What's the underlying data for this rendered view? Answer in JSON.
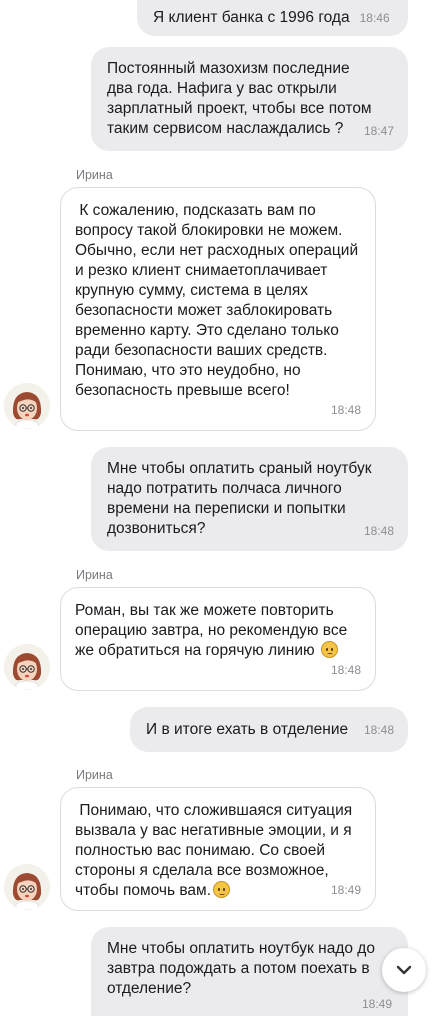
{
  "messages": [
    {
      "type": "out",
      "text": "Я клиент банка с 1996 года",
      "time": "18:46"
    },
    {
      "type": "out",
      "text": "Постоянный мазохизм последние два года. Нафига у вас открыли зарплатный проект, чтобы все потом таким сервисом наслаждались ?",
      "time": "18:47"
    },
    {
      "type": "in",
      "sender": "Ирина",
      "text": " К сожалению, подсказать вам по вопросу такой блокировки не можем. Обычно, если нет расходных операций и резко клиент снимаетоплачивает крупную сумму, система в целях безопасности может заблокировать временно карту. Это сделано только ради безопасности ваших средств. Понимаю, что это неудобно, но безопасность превыше всего!",
      "time": "18:48"
    },
    {
      "type": "out",
      "text": "Мне чтобы оплатить сраный ноутбук надо потратить полчаса личного времени на переписки и попытки дозвониться?",
      "time": "18:48"
    },
    {
      "type": "in",
      "sender": "Ирина",
      "text": "Роман, вы так же можете повторить операцию завтра, но рекомендую все же обратиться на горячую линию",
      "time": "18:48"
    },
    {
      "type": "out",
      "text": "И в итоге ехать в отделение",
      "time": "18:48"
    },
    {
      "type": "in",
      "sender": "Ирина",
      "text": " Понимаю, что сложившаяся ситуация вызвала у вас негативные эмоции, и я полностью вас понимаю. Со своей стороны я сделала все возможное, чтобы помочь вам.",
      "time": "18:49"
    },
    {
      "type": "out",
      "text": "Мне чтобы оплатить ноутбук надо до завтра подождать а потом поехать в отделение?",
      "time": "18:49"
    }
  ],
  "icons": {
    "avatar": "operator-avatar-icon",
    "emoji_slight": "slightly-frowning-face-icon",
    "emoji_pensive": "pensive-face-icon",
    "scroll": "chevron-down-icon"
  },
  "colors": {
    "outgoing_bubble": "#ebebee",
    "incoming_border": "#dcdce0",
    "time": "#8d8d93"
  }
}
